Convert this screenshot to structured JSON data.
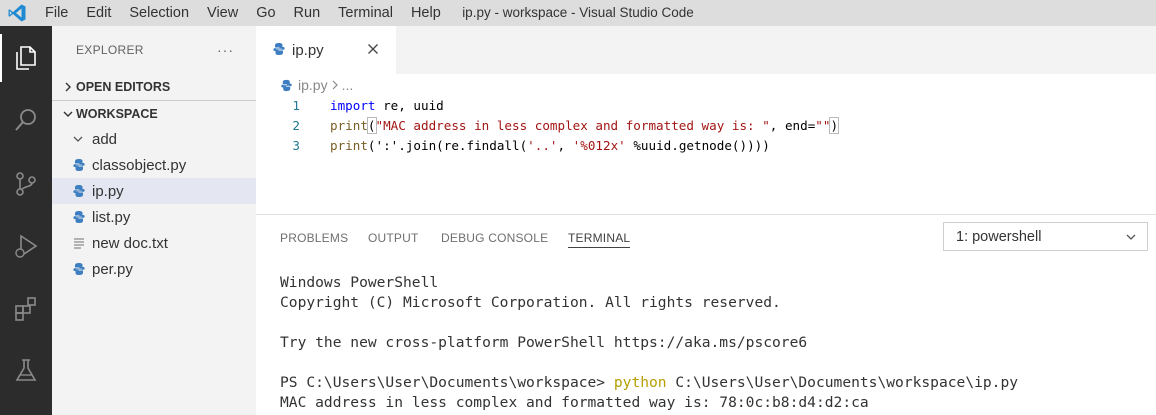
{
  "titlebar": {
    "menu": [
      "File",
      "Edit",
      "Selection",
      "View",
      "Go",
      "Run",
      "Terminal",
      "Help"
    ],
    "window_title": "ip.py - workspace - Visual Studio Code"
  },
  "activity_bar": {
    "items": [
      "explorer-icon",
      "search-icon",
      "source-control-icon",
      "run-debug-icon",
      "extensions-icon",
      "testing-icon"
    ]
  },
  "sidebar": {
    "header": "EXPLORER",
    "more": "···",
    "open_editors": "OPEN EDITORS",
    "workspace": "WORKSPACE",
    "items": [
      {
        "label": "add",
        "type": "folder"
      },
      {
        "label": "classobject.py",
        "type": "python"
      },
      {
        "label": "ip.py",
        "type": "python"
      },
      {
        "label": "list.py",
        "type": "python"
      },
      {
        "label": "new doc.txt",
        "type": "text"
      },
      {
        "label": "per.py",
        "type": "python"
      }
    ]
  },
  "editor": {
    "tab_label": "ip.py",
    "breadcrumb_file": "ip.py",
    "breadcrumb_more": "...",
    "lines": [
      {
        "num": "1",
        "kw": "import",
        "rest": " re, uuid"
      },
      {
        "num": "2",
        "fn": "print",
        "open": "(",
        "str1": "\"MAC address in less complex and formatted way is: \"",
        "mid": ", end=",
        "str2": "\"\"",
        "close": ")"
      },
      {
        "num": "3",
        "fn": "print",
        "a": "(':'.join(re.findall(",
        "s1": "'..'",
        "b": ", ",
        "s2": "'%012x'",
        "c": " %uuid.getnode())))"
      }
    ]
  },
  "panel": {
    "tabs": [
      "PROBLEMS",
      "OUTPUT",
      "DEBUG CONSOLE",
      "TERMINAL"
    ],
    "active_tab": "TERMINAL",
    "terminal_select": "1: powershell",
    "terminal": {
      "line1": "Windows PowerShell",
      "line2": "Copyright (C) Microsoft Corporation. All rights reserved.",
      "line3": "",
      "line4": "Try the new cross-platform PowerShell https://aka.ms/pscore6",
      "line5": "",
      "prompt": "PS C:\\Users\\User\\Documents\\workspace> ",
      "cmd": "python",
      "cmd_arg": " C:\\Users\\User\\Documents\\workspace\\ip.py",
      "output": "MAC address in less complex and formatted way is: 78:0c:b8:d4:d2:ca"
    }
  },
  "colors": {
    "activity_bar": "#2c2c2c",
    "sidebar": "#f3f3f3",
    "titlebar": "#dddddd",
    "keyword": "#0000ff",
    "string": "#a31515",
    "python_icon": "#3c7ebf"
  }
}
